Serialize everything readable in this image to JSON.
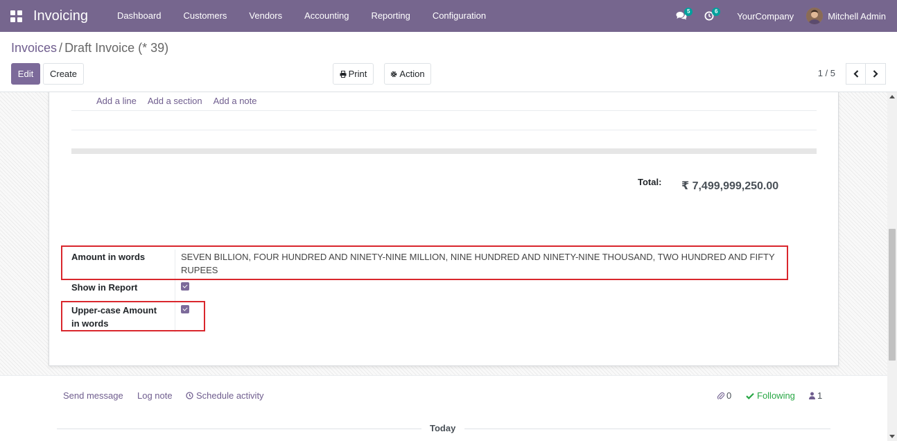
{
  "navbar": {
    "app_name": "Invoicing",
    "menu": [
      "Dashboard",
      "Customers",
      "Vendors",
      "Accounting",
      "Reporting",
      "Configuration"
    ],
    "messages_count": "5",
    "activities_count": "6",
    "company": "YourCompany",
    "user": "Mitchell Admin"
  },
  "breadcrumb": {
    "parent": "Invoices",
    "separator": "/",
    "current": "Draft Invoice (* 39)"
  },
  "buttons": {
    "edit": "Edit",
    "create": "Create",
    "print": "Print",
    "action": "Action"
  },
  "pager": {
    "value": "1 / 5"
  },
  "lines": {
    "add_line": "Add a line",
    "add_section": "Add a section",
    "add_note": "Add a note"
  },
  "totals": {
    "label": "Total:",
    "value": "₹ 7,499,999,250.00"
  },
  "fields": {
    "amount_words_label": "Amount in words",
    "amount_words_line1": "SEVEN BILLION, FOUR HUNDRED AND NINETY-NINE MILLION, NINE HUNDRED AND NINETY-NINE THOUSAND, TWO HUNDRED AND FIFTY",
    "amount_words_line2": "RUPEES",
    "show_report_label": "Show in Report",
    "show_report_checked": true,
    "uppercase_label_line1": "Upper-case Amount",
    "uppercase_label_line2": "in words",
    "uppercase_checked": true
  },
  "chatter": {
    "send_message": "Send message",
    "log_note": "Log note",
    "schedule_activity": "Schedule activity",
    "attachments_count": "0",
    "following": "Following",
    "followers_count": "1",
    "today": "Today"
  },
  "colors": {
    "navbar": "#76668e",
    "primary": "#7c6a9a",
    "link": "#6f5d8e",
    "highlight_box": "#d9262c",
    "following": "#28a745"
  }
}
